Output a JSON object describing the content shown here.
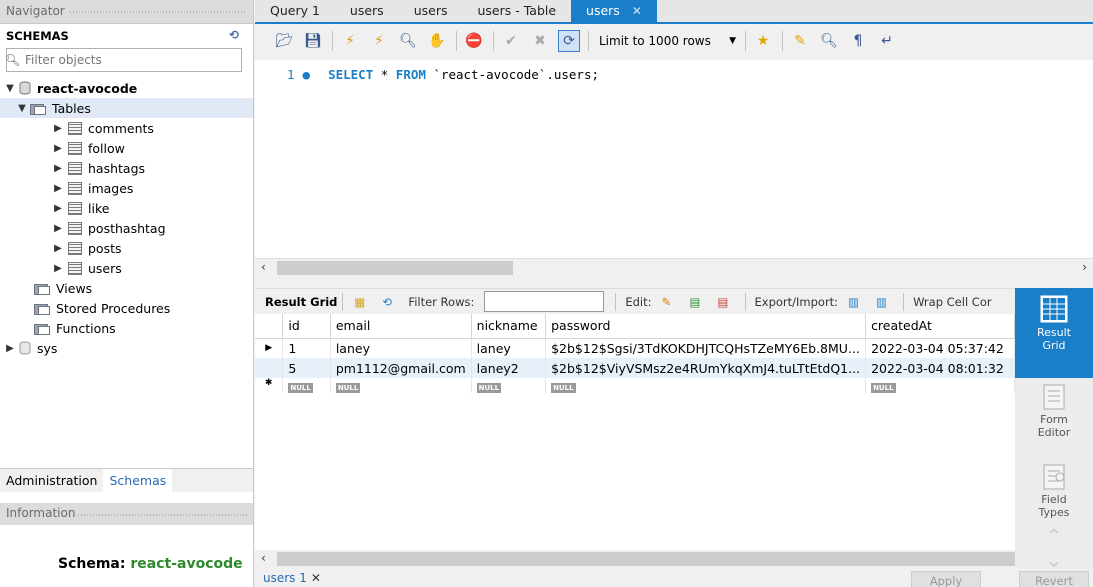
{
  "navigator": {
    "title": "Navigator",
    "schemas_label": "SCHEMAS",
    "filter_placeholder": "Filter objects",
    "tree": {
      "db": "react-avocode",
      "tables_label": "Tables",
      "tables": [
        "comments",
        "follow",
        "hashtags",
        "images",
        "like",
        "posthashtag",
        "posts",
        "users"
      ],
      "views": "Views",
      "procs": "Stored Procedures",
      "funcs": "Functions",
      "sys": "sys"
    },
    "tabs": [
      "Administration",
      "Schemas"
    ],
    "info_title": "Information",
    "schema_label": "Schema:",
    "schema_value": "react-avocode"
  },
  "tabs": [
    {
      "label": "Query 1",
      "active": false
    },
    {
      "label": "users",
      "active": false
    },
    {
      "label": "users",
      "active": false
    },
    {
      "label": "users - Table",
      "active": false
    },
    {
      "label": "users",
      "active": true
    }
  ],
  "toolbar": {
    "limit": "Limit to 1000 rows"
  },
  "editor": {
    "line": "1",
    "sql_keyword1": "SELECT",
    "sql_rest1": " * ",
    "sql_keyword2": "FROM",
    "sql_rest2": " `react-avocode`.users;"
  },
  "result_bar": {
    "result_grid": "Result Grid",
    "filter_rows": "Filter Rows:",
    "edit": "Edit:",
    "export": "Export/Import:",
    "wrap": "Wrap Cell Cor"
  },
  "grid": {
    "columns": [
      "id",
      "email",
      "nickname",
      "password",
      "createdAt"
    ],
    "rows": [
      [
        "1",
        "laney",
        "laney",
        "$2b$12$Sgsi/3TdKOKDHJTCQHsTZeMY6Eb.8MU...",
        "2022-03-04 05:37:42"
      ],
      [
        "5",
        "pm1112@gmail.com",
        "laney2",
        "$2b$12$ViyVSMsz2e4RUmYkqXmJ4.tuLTtEtdQ1...",
        "2022-03-04 08:01:32"
      ]
    ],
    "null_label": "NULL"
  },
  "side": {
    "result_grid": [
      "Result",
      "Grid"
    ],
    "form_editor": [
      "Form",
      "Editor"
    ],
    "field_types": [
      "Field",
      "Types"
    ]
  },
  "bottom": {
    "result_tab": "users 1",
    "apply": "Apply",
    "revert": "Revert"
  }
}
